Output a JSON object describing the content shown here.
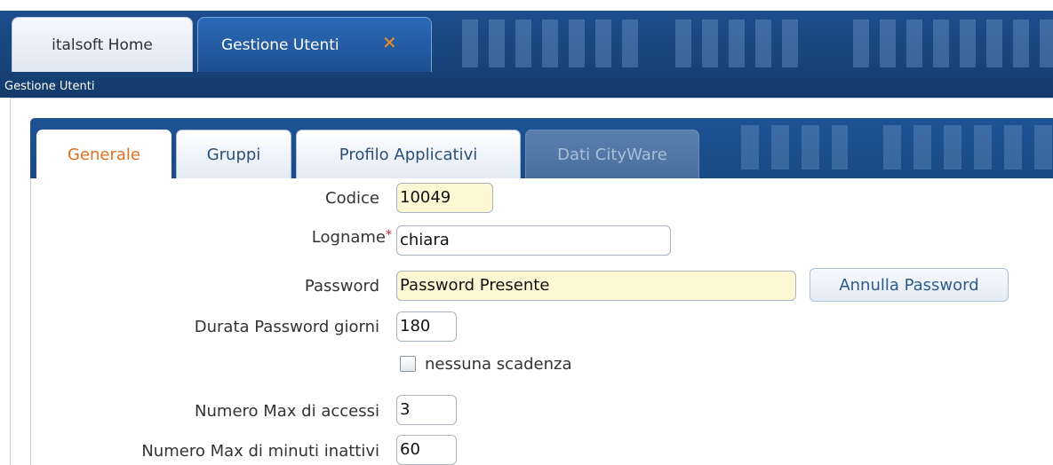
{
  "main_tabs": [
    {
      "label": "italsoft Home",
      "active": false
    },
    {
      "label": "Gestione Utenti",
      "active": true,
      "closable": true,
      "close_icon": "close-icon"
    }
  ],
  "section_title": "Gestione Utenti",
  "sub_tabs": [
    {
      "label": "Generale",
      "state": "selected"
    },
    {
      "label": "Gruppi",
      "state": "normal"
    },
    {
      "label": "Profilo Applicativi",
      "state": "normal"
    },
    {
      "label": "Dati CityWare",
      "state": "disabled"
    }
  ],
  "form": {
    "codice": {
      "label": "Codice",
      "value": "10049"
    },
    "logname": {
      "label": "Logname",
      "required_mark": "*",
      "value": "chiara"
    },
    "password": {
      "label": "Password",
      "value": "Password Presente",
      "button": "Annulla Password"
    },
    "durata": {
      "label": "Durata Password giorni",
      "value": "180"
    },
    "nessuna_scadenza": {
      "label": "nessuna scadenza",
      "checked": false
    },
    "max_accessi": {
      "label": "Numero Max di accessi",
      "value": "3"
    },
    "max_minuti": {
      "label": "Numero Max di minuti inattivi",
      "value": "60"
    }
  },
  "colors": {
    "header_blue": "#1d4d8e",
    "selected_tab_text": "#e07020",
    "close_icon": "#f08a24",
    "readonly_field": "#fdf8d3",
    "required_mark": "#d02020"
  }
}
